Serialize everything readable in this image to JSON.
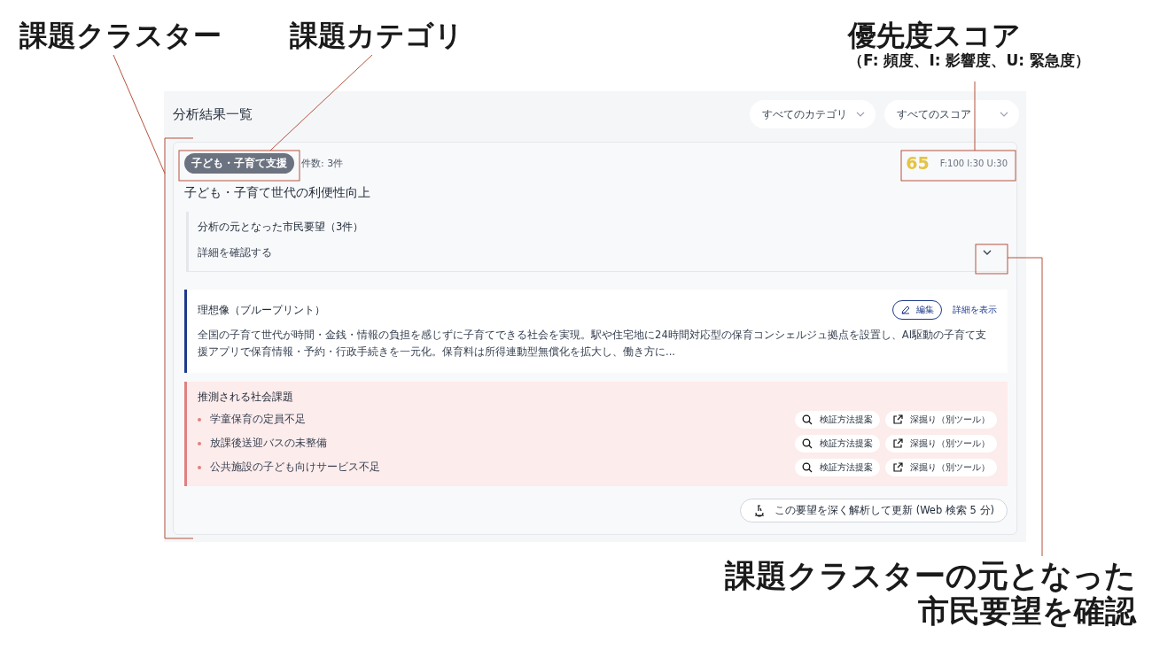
{
  "annotations": [
    {
      "lines": [
        "課題クラスター"
      ]
    },
    {
      "lines": [
        "課題カテゴリ"
      ]
    },
    {
      "lines": [
        "優先度スコア",
        "（F: 頻度、I: 影響度、U: 緊急度）"
      ]
    },
    {
      "lines": [
        "課題クラスターの元となった",
        "市民要望を確認"
      ]
    }
  ],
  "panel": {
    "title": "分析結果一覧",
    "filters": [
      "すべてのカテゴリ",
      "すべてのスコア"
    ]
  },
  "cluster": {
    "category": "子ども・子育て支援",
    "count": "件数: 3件",
    "score": "65",
    "score_detail": "F:100 I:30 U:30",
    "title": "子ども・子育て世代の利便性向上",
    "source": {
      "title": "分析の元となった市民要望（3件）",
      "link": "詳細を確認する",
      "expanded": false
    },
    "blueprint": {
      "title": "理想像（ブループリント）",
      "edit": "編集",
      "view": "詳細を表示",
      "text": "全国の子育て世代が時間・金銭・情報の負担を感じずに子育てできる社会を実現。駅や住宅地に24時間対応型の保育コンシェルジュ拠点を設置し、AI駆動の子育て支援アプリで保育情報・予約・行政手続きを一元化。保育料は所得連動型無償化を拡大し、働き方に..."
    },
    "issues": {
      "title": "推測される社会課題",
      "items": [
        {
          "text": "学童保育の定員不足",
          "verify": "検証方法提案",
          "dig": "深掘り（別ツール）"
        },
        {
          "text": "放課後送迎バスの未整備",
          "verify": "検証方法提案",
          "dig": "深掘り（別ツール）"
        },
        {
          "text": "公共施設の子ども向けサービス不足",
          "verify": "検証方法提案",
          "dig": "深掘り（別ツール）"
        }
      ]
    },
    "update_button": "この要望を深く解析して更新 (Web 検索 5 分)"
  }
}
